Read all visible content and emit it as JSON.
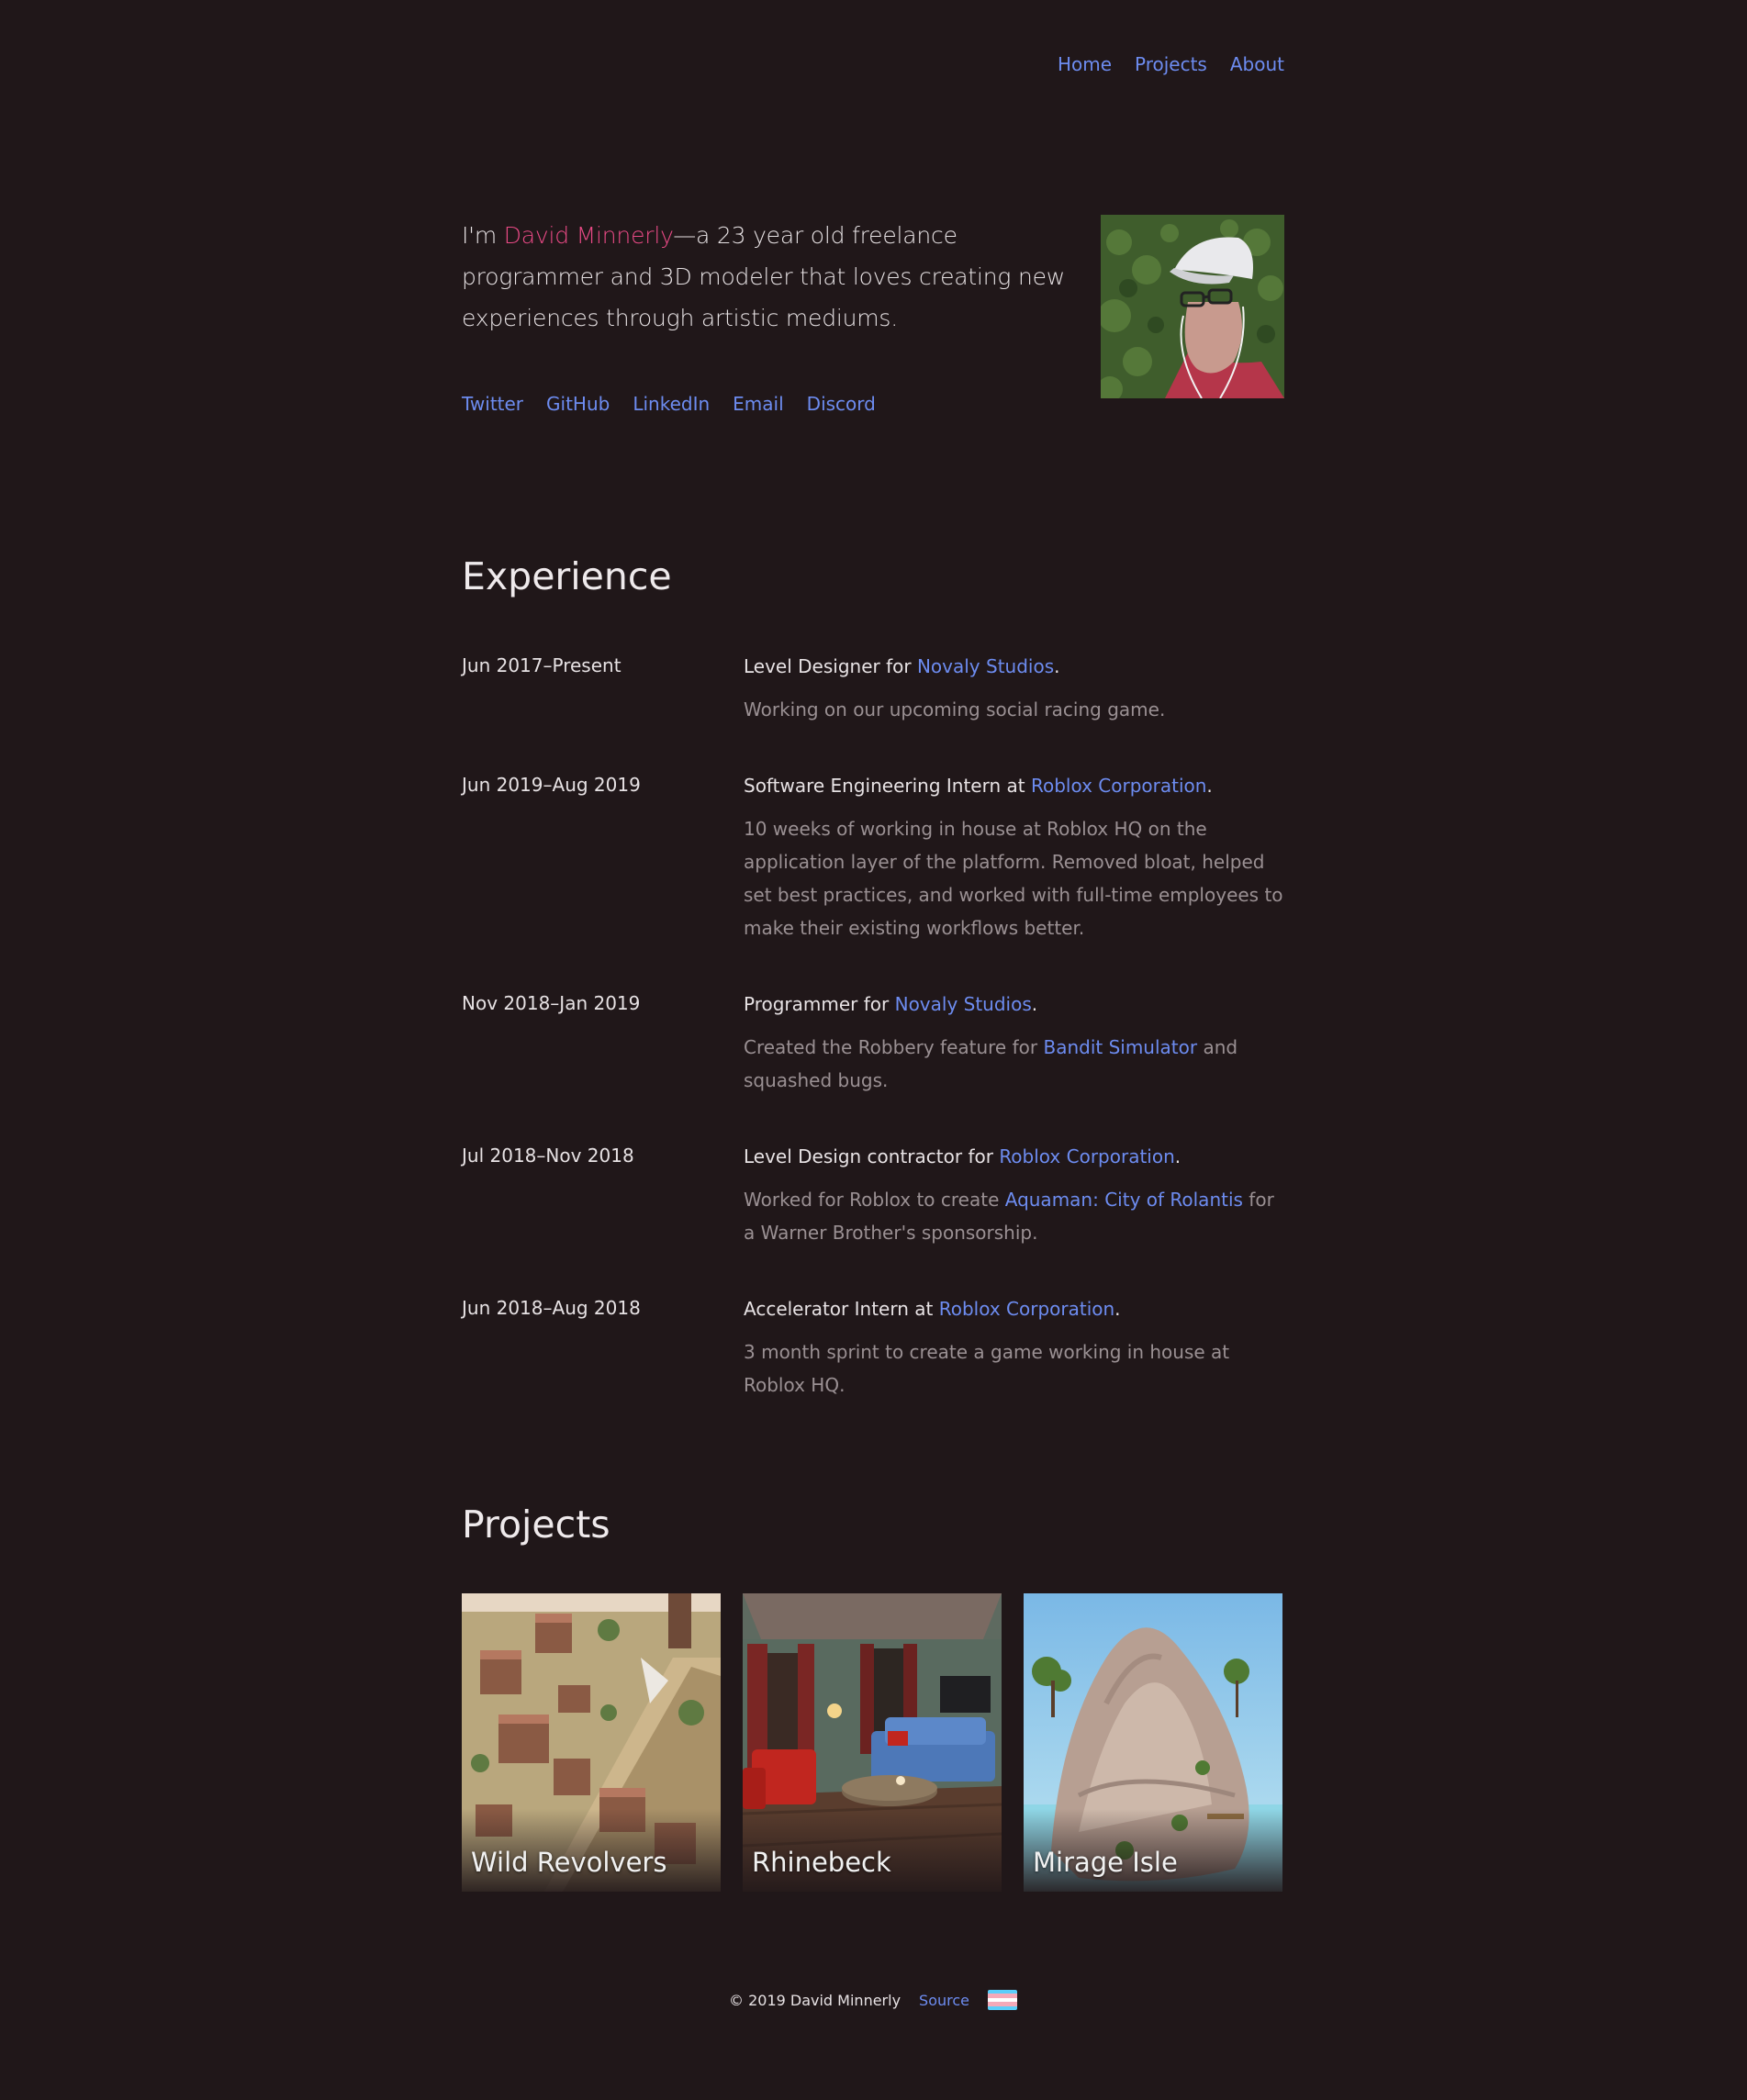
{
  "nav": {
    "home": "Home",
    "projects": "Projects",
    "about": "About"
  },
  "intro": {
    "prefix": "I'm ",
    "name": "David Minnerly",
    "suffix": "—a 23 year old freelance programmer and 3D modeler that loves creating new experiences through artistic mediums."
  },
  "social": [
    "Twitter",
    "GitHub",
    "LinkedIn",
    "Email",
    "Discord"
  ],
  "experience": {
    "title": "Experience",
    "items": [
      {
        "date": "Jun 2017–Present",
        "role_prefix": "Level Designer for ",
        "company": "Novaly Studios",
        "role_suffix": ".",
        "desc_prefix": "Working on our upcoming social racing game.",
        "desc_link": "",
        "desc_suffix": ""
      },
      {
        "date": "Jun 2019–Aug 2019",
        "role_prefix": "Software Engineering Intern at ",
        "company": "Roblox Corporation",
        "role_suffix": ".",
        "desc_prefix": "10 weeks of working in house at Roblox HQ on the application layer of the platform. Removed bloat, helped set best practices, and worked with full-time employees to make their existing workflows better.",
        "desc_link": "",
        "desc_suffix": ""
      },
      {
        "date": "Nov 2018–Jan 2019",
        "role_prefix": "Programmer for ",
        "company": "Novaly Studios",
        "role_suffix": ".",
        "desc_prefix": "Created the Robbery feature for ",
        "desc_link": "Bandit Simulator",
        "desc_suffix": " and squashed bugs."
      },
      {
        "date": "Jul 2018–Nov 2018",
        "role_prefix": "Level Design contractor for ",
        "company": "Roblox Corporation",
        "role_suffix": ".",
        "desc_prefix": "Worked for Roblox to create ",
        "desc_link": "Aquaman: City of Rolantis",
        "desc_suffix": " for a Warner Brother's sponsorship."
      },
      {
        "date": "Jun 2018–Aug 2018",
        "role_prefix": "Accelerator Intern at ",
        "company": "Roblox Corporation",
        "role_suffix": ".",
        "desc_prefix": "3 month sprint to create a game working in house at Roblox HQ.",
        "desc_link": "",
        "desc_suffix": ""
      }
    ]
  },
  "projects": {
    "title": "Projects",
    "items": [
      "Wild Revolvers",
      "Rhinebeck",
      "Mirage Isle"
    ]
  },
  "footer": {
    "copyright": "© 2019 David Minnerly",
    "source": "Source",
    "flag_colors": [
      "#5bcefa",
      "#f5a9b8",
      "#ffffff",
      "#f5a9b8",
      "#5bcefa"
    ]
  }
}
